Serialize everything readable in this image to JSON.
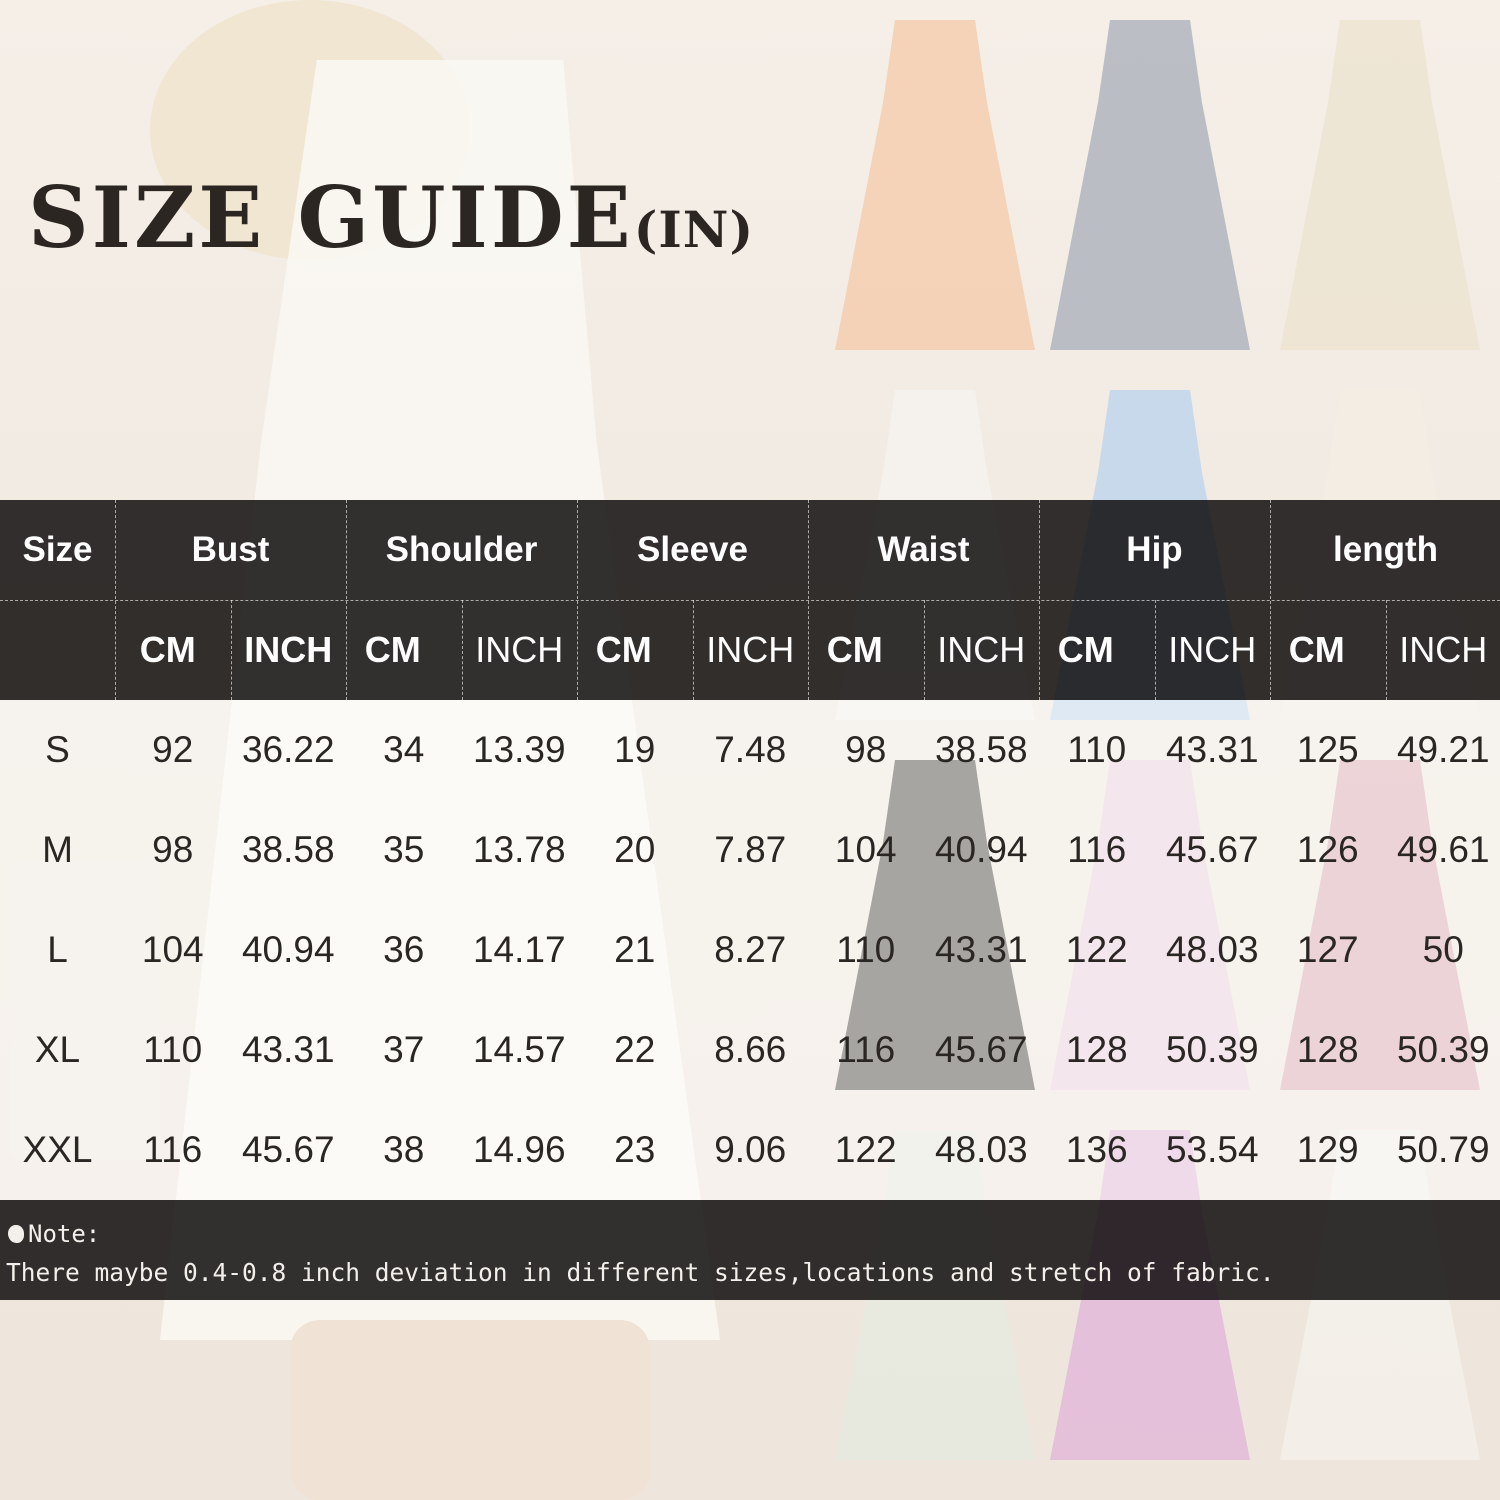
{
  "title": {
    "main": "SIZE GUIDE",
    "unit": "(IN)"
  },
  "table": {
    "size_header": "Size",
    "groups": [
      "Bust",
      "Shoulder",
      "Sleeve",
      "Waist",
      "Hip",
      "length"
    ],
    "units": [
      "CM",
      "INCH"
    ],
    "rows": [
      {
        "size": "S",
        "values": [
          "92",
          "36.22",
          "34",
          "13.39",
          "19",
          "7.48",
          "98",
          "38.58",
          "110",
          "43.31",
          "125",
          "49.21"
        ]
      },
      {
        "size": "M",
        "values": [
          "98",
          "38.58",
          "35",
          "13.78",
          "20",
          "7.87",
          "104",
          "40.94",
          "116",
          "45.67",
          "126",
          "49.61"
        ]
      },
      {
        "size": "L",
        "values": [
          "104",
          "40.94",
          "36",
          "14.17",
          "21",
          "8.27",
          "110",
          "43.31",
          "122",
          "48.03",
          "127",
          "50"
        ]
      },
      {
        "size": "XL",
        "values": [
          "110",
          "43.31",
          "37",
          "14.57",
          "22",
          "8.66",
          "116",
          "45.67",
          "128",
          "50.39",
          "128",
          "50.39"
        ]
      },
      {
        "size": "XXL",
        "values": [
          "116",
          "45.67",
          "38",
          "14.96",
          "23",
          "9.06",
          "122",
          "48.03",
          "136",
          "53.54",
          "129",
          "50.79"
        ]
      }
    ]
  },
  "note": {
    "label": "Note:",
    "text": "There maybe 0.4-0.8 inch deviation in different sizes,locations and stretch of fabric."
  },
  "swatch_colors": [
    "#f4c9a8",
    "#a7adb8",
    "#ece3cf",
    "#f6f4f1",
    "#b9d3ee",
    "#f3ede4",
    "#3b3836",
    "#e8cfe0",
    "#d9a3ad",
    "#e6eadf",
    "#e0b3d8",
    "#f4f1ec"
  ]
}
